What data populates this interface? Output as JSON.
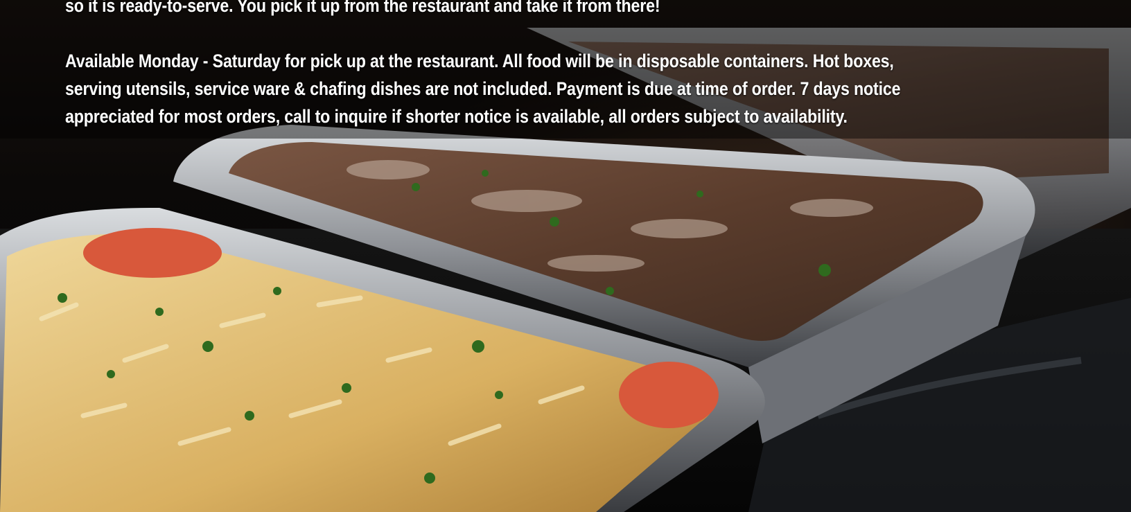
{
  "catering": {
    "intro_tail": "so it is ready-to-serve. You pick it up from the restaurant and take it from there!",
    "details": "Available Monday - Saturday for pick up at the restaurant. All food will be in disposable containers. Hot boxes, serving utensils, service ware & chafing dishes are not included. Payment is due at time of order. 7 days notice appreciated for most orders, call to inquire if shorter notice is available, all orders subject to availability."
  },
  "background": {
    "image": "catering-trays-photo",
    "colors": {
      "foil": "#b9bcc0",
      "pasta": "#e3c27a",
      "meat": "#6b4a36",
      "herb": "#2f6a1e",
      "tomato": "#d8583b"
    }
  }
}
